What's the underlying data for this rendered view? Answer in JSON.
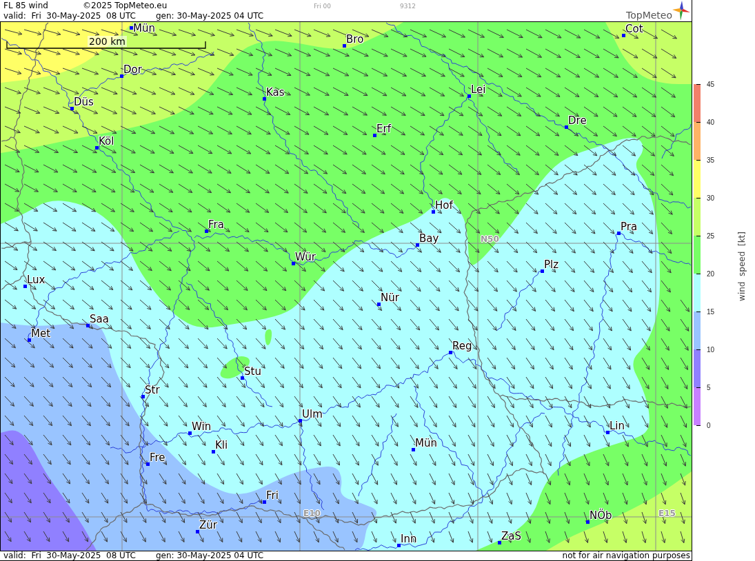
{
  "header": {
    "title": "FL 85 wind",
    "copyright": "©2025 TopMeteo.eu",
    "run": "Fri 00",
    "code": "9312",
    "valid": "valid:  Fri  30-May-2025  08 UTC",
    "generated": "gen: 30-May-2025 04 UTC",
    "logo": "TopMeteo"
  },
  "map": {
    "scale_bar": "200 km",
    "grid_labels": [
      "N50",
      "E10",
      "E15"
    ],
    "cities": [
      "Mün",
      "Cot",
      "Bro",
      "Dor",
      "Lei",
      "Kas",
      "Düs",
      "Dre",
      "Erf",
      "Köl",
      "Hof",
      "Fra",
      "Pra",
      "Bay",
      "Wür",
      "Plz",
      "Lux",
      "Nür",
      "Saa",
      "Met",
      "Reg",
      "Stu",
      "Str",
      "Ulm",
      "Lin",
      "Win",
      "Mün",
      "Kli",
      "Fre",
      "Fri",
      "NÖb",
      "Zür",
      "ZaS",
      "Inn"
    ]
  },
  "legend": {
    "title": "wind  speed  [kt]",
    "ticks": [
      "45",
      "40",
      "35",
      "30",
      "25",
      "20",
      "15",
      "10",
      "5",
      "0"
    ],
    "bands": [
      {
        "color": "#f2806a"
      },
      {
        "color": "#ffb366"
      },
      {
        "color": "#ffff66"
      },
      {
        "color": "#c6ff66"
      },
      {
        "color": "#78ff66"
      },
      {
        "color": "#aeffff"
      },
      {
        "color": "#99c4ff"
      },
      {
        "color": "#9080ff"
      },
      {
        "color": "#c880ff"
      }
    ]
  },
  "footer": {
    "valid": "valid:  Fri  30-May-2025  08 UTC",
    "generated": "gen: 30-May-2025 04 UTC",
    "disclaimer": "not for air navigation purposes"
  }
}
